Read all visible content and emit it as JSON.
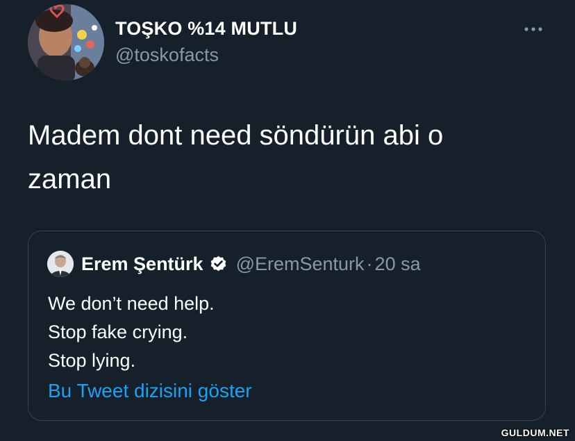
{
  "tweet": {
    "author": {
      "display_name": "TOŞKO %14 MUTLU",
      "handle": "@toskofacts",
      "avatar_icon": "profile-photo"
    },
    "more_icon": "more-horizontal-icon",
    "text": "Madem dont need söndürün abi o\nzaman"
  },
  "quoted_tweet": {
    "author": {
      "display_name": "Erem Şentürk",
      "handle": "@EremSenturk",
      "verified": true,
      "avatar_icon": "profile-photo"
    },
    "separator": "·",
    "time": "20 sa",
    "text": "We don’t need help.\nStop fake crying.\nStop lying.",
    "thread_link": "Bu Tweet dizisini göster"
  },
  "watermark": "GULDUM.NET",
  "colors": {
    "background": "#15202b",
    "primary_text": "#ffffff",
    "secondary_text": "#8899a6",
    "link": "#1da1f2",
    "border": "#38444d"
  }
}
